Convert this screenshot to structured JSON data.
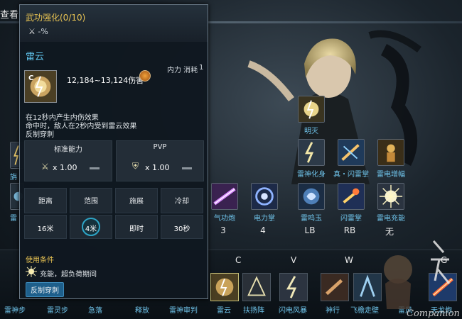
{
  "window": {
    "title": "查看"
  },
  "tooltip": {
    "title": "武功强化(0/10)",
    "modifier": "-%",
    "skill_name": "雷云",
    "cost_label": "内力 消耗",
    "cost_value": "1",
    "grade": "C",
    "damage": "12,184~13,124伤害",
    "description": [
      "在12秒内产生内伤效果",
      "命中时，敌人在2秒内受到雷云效果",
      "反制穿刺"
    ],
    "ability": {
      "standard_label": "标准能力",
      "pvp_label": "PVP",
      "standard_mult": "x 1.00",
      "pvp_mult": "x 1.00"
    },
    "stats": [
      {
        "label": "距离",
        "value": "16米"
      },
      {
        "label": "范围",
        "value": "4米"
      },
      {
        "label": "施展",
        "value": "即时"
      },
      {
        "label": "冷却",
        "value": "30秒"
      }
    ],
    "conditions_label": "使用条件",
    "conditions": "充能，超负荷期间",
    "tag": "反制穿刺"
  },
  "skills": [
    {
      "name": "明灭",
      "key": ""
    },
    {
      "name": "雷神化身",
      "key": ""
    },
    {
      "name": "真・闪雷掌",
      "key": ""
    },
    {
      "name": "雷电增幅",
      "key": ""
    },
    {
      "name": "气功炮",
      "key": "3"
    },
    {
      "name": "电力掌",
      "key": "4"
    },
    {
      "name": "雷鸣玉",
      "key": "LB"
    },
    {
      "name": "闪雷掌",
      "key": "RB"
    },
    {
      "name": "雷电充能",
      "key": "无"
    }
  ],
  "left_partial": [
    "旃",
    "雷"
  ],
  "bottom_bar": {
    "keys": [
      "C",
      "V",
      "W",
      "G"
    ],
    "names": [
      "雷神步",
      "雷灵步",
      "急落",
      "释放",
      "雷神审判",
      "雷云",
      "扶扬阵",
      "闪电风暴",
      "神行",
      "飞檐走壁",
      "雷风",
      "天龙炮"
    ]
  },
  "watermark": {
    "text": "Companion"
  }
}
